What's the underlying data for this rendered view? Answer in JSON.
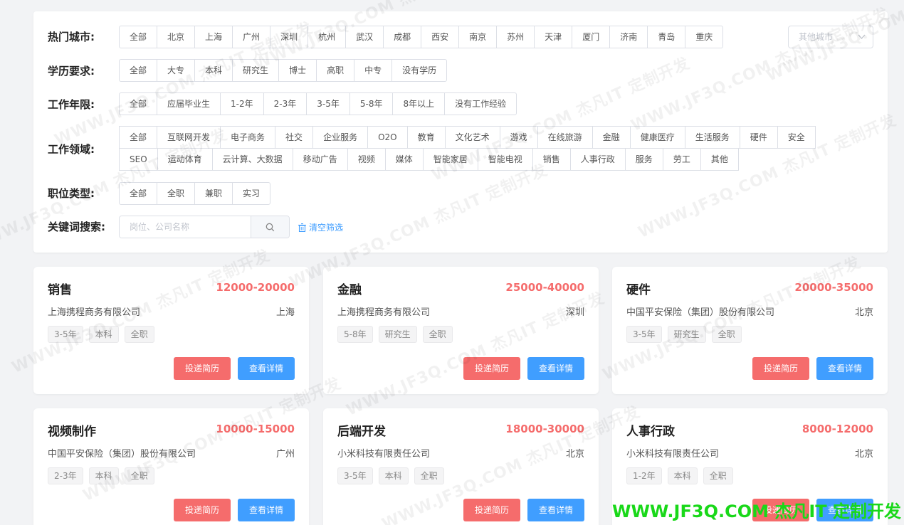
{
  "filters": {
    "city": {
      "label": "热门城市:",
      "options": [
        "全部",
        "北京",
        "上海",
        "广州",
        "深圳",
        "杭州",
        "武汉",
        "成都",
        "西安",
        "南京",
        "苏州",
        "天津",
        "厦门",
        "济南",
        "青岛",
        "重庆"
      ],
      "other_placeholder": "其他城市"
    },
    "education": {
      "label": "学历要求:",
      "options": [
        "全部",
        "大专",
        "本科",
        "研究生",
        "博士",
        "高职",
        "中专",
        "没有学历"
      ]
    },
    "experience": {
      "label": "工作年限:",
      "options": [
        "全部",
        "应届毕业生",
        "1-2年",
        "2-3年",
        "3-5年",
        "5-8年",
        "8年以上",
        "没有工作经验"
      ]
    },
    "industry": {
      "label": "工作领域:",
      "options": [
        "全部",
        "互联网开发",
        "电子商务",
        "社交",
        "企业服务",
        "O2O",
        "教育",
        "文化艺术",
        "游戏",
        "在线旅游",
        "金融",
        "健康医疗",
        "生活服务",
        "硬件",
        "安全",
        "SEO",
        "运动体育",
        "云计算、大数据",
        "移动广告",
        "视频",
        "媒体",
        "智能家居",
        "智能电视",
        "销售",
        "人事行政",
        "服务",
        "劳工",
        "其他"
      ]
    },
    "job_type": {
      "label": "职位类型:",
      "options": [
        "全部",
        "全职",
        "兼职",
        "实习"
      ]
    },
    "keyword": {
      "label": "关键词搜索:",
      "placeholder": "岗位、公司名称",
      "clear_label": "清空筛选"
    }
  },
  "jobs": [
    {
      "title": "销售",
      "salary": "12000-20000",
      "company": "上海携程商务有限公司",
      "city": "上海",
      "tags": [
        "3-5年",
        "本科",
        "全职"
      ]
    },
    {
      "title": "金融",
      "salary": "25000-40000",
      "company": "上海携程商务有限公司",
      "city": "深圳",
      "tags": [
        "5-8年",
        "研究生",
        "全职"
      ]
    },
    {
      "title": "硬件",
      "salary": "20000-35000",
      "company": "中国平安保险（集团）股份有限公司",
      "city": "北京",
      "tags": [
        "3-5年",
        "研究生",
        "全职"
      ]
    },
    {
      "title": "视频制作",
      "salary": "10000-15000",
      "company": "中国平安保险（集团）股份有限公司",
      "city": "广州",
      "tags": [
        "2-3年",
        "本科",
        "全职"
      ]
    },
    {
      "title": "后端开发",
      "salary": "18000-30000",
      "company": "小米科技有限责任公司",
      "city": "北京",
      "tags": [
        "3-5年",
        "本科",
        "全职"
      ]
    },
    {
      "title": "人事行政",
      "salary": "8000-12000",
      "company": "小米科技有限责任公司",
      "city": "北京",
      "tags": [
        "1-2年",
        "本科",
        "全职"
      ]
    }
  ],
  "buttons": {
    "apply": "投递简历",
    "detail": "查看详情"
  },
  "watermark": "WWW.JF3Q.COM 杰凡IT 定制开发",
  "colors": {
    "accent": "#409eff",
    "danger": "#f56c6c"
  }
}
